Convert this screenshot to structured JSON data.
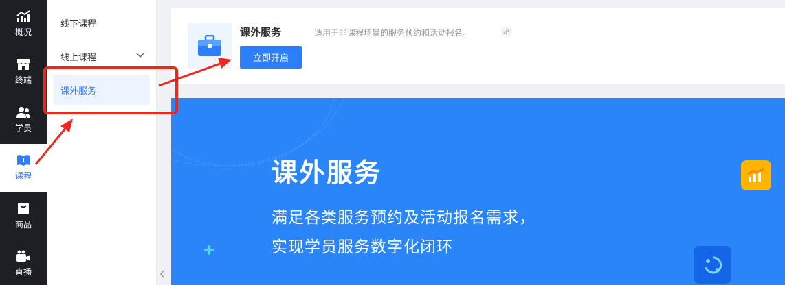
{
  "rail": {
    "items": [
      {
        "label": "概况",
        "icon": "trend-chart-icon"
      },
      {
        "label": "终端",
        "icon": "storefront-icon"
      },
      {
        "label": "学员",
        "icon": "users-icon"
      },
      {
        "label": "课程",
        "icon": "book-icon"
      },
      {
        "label": "商品",
        "icon": "shopping-bag-icon"
      },
      {
        "label": "直播",
        "icon": "video-camera-icon"
      }
    ],
    "active_index": 3
  },
  "submenu": {
    "items": [
      {
        "label": "线下课程"
      },
      {
        "label": "线上课程"
      },
      {
        "label": "课外服务"
      }
    ],
    "active_index": 2
  },
  "app_card": {
    "title": "课外服务",
    "description": "适用于非课程场景的服务预约和活动报名。",
    "open_button": "立即开启"
  },
  "banner": {
    "title": "课外服务",
    "subtitle_line1": "满足各类服务预约及活动报名需求，",
    "subtitle_line2": "实现学员服务数字化闭环"
  },
  "colors": {
    "accent": "#2d7ff9",
    "rail_bg": "#1d1f24",
    "banner_bg": "#2a86f8",
    "annotation_red": "#f0261b"
  }
}
